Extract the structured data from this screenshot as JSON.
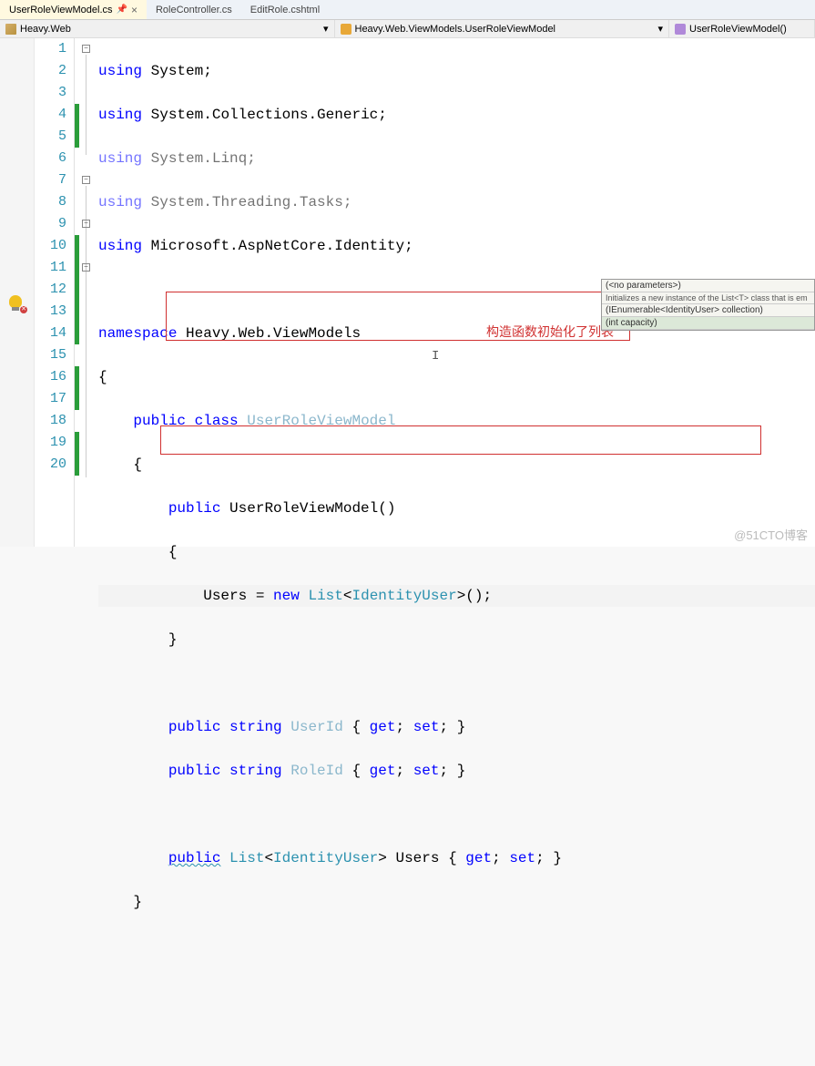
{
  "tabs": [
    {
      "label": "UserRoleViewModel.cs",
      "active": true
    },
    {
      "label": "RoleController.cs",
      "active": false
    },
    {
      "label": "EditRole.cshtml",
      "active": false
    }
  ],
  "navbar": {
    "project": "Heavy.Web",
    "class": "Heavy.Web.ViewModels.UserRoleViewModel",
    "member": "UserRoleViewModel()"
  },
  "lines": [
    "1",
    "2",
    "3",
    "4",
    "5",
    "6",
    "7",
    "8",
    "9",
    "10",
    "11",
    "12",
    "13",
    "14",
    "15",
    "16",
    "17",
    "18",
    "19",
    "20"
  ],
  "code": {
    "kw_using": "using",
    "kw_namespace": "namespace",
    "kw_public": "public",
    "kw_class": "class",
    "kw_new": "new",
    "kw_string": "string",
    "kw_get": "get",
    "kw_set": "set",
    "System": "System",
    "Collections_Generic": "System.Collections.Generic",
    "Linq": "System.Linq",
    "Threading_Tasks": "System.Threading.Tasks",
    "AspNetCore_Identity": "Microsoft.AspNetCore.Identity",
    "ns": "Heavy.Web.ViewModels",
    "className": "UserRoleViewModel",
    "ctor": "UserRoleViewModel",
    "Users": "Users",
    "List": "List",
    "IdentityUser": "IdentityUser",
    "UserId": "UserId",
    "RoleId": "RoleId",
    "prop_Users": "Users"
  },
  "tooltip": {
    "l1": "(<no parameters>)",
    "l2": "Initializes a new instance of the List<T> class that is em",
    "l3": "(IEnumerable<IdentityUser> collection)",
    "l4": "(int capacity)"
  },
  "annotations": {
    "ctor_label": "构造函数初始化了列表"
  },
  "watermark": "@51CTO博客"
}
